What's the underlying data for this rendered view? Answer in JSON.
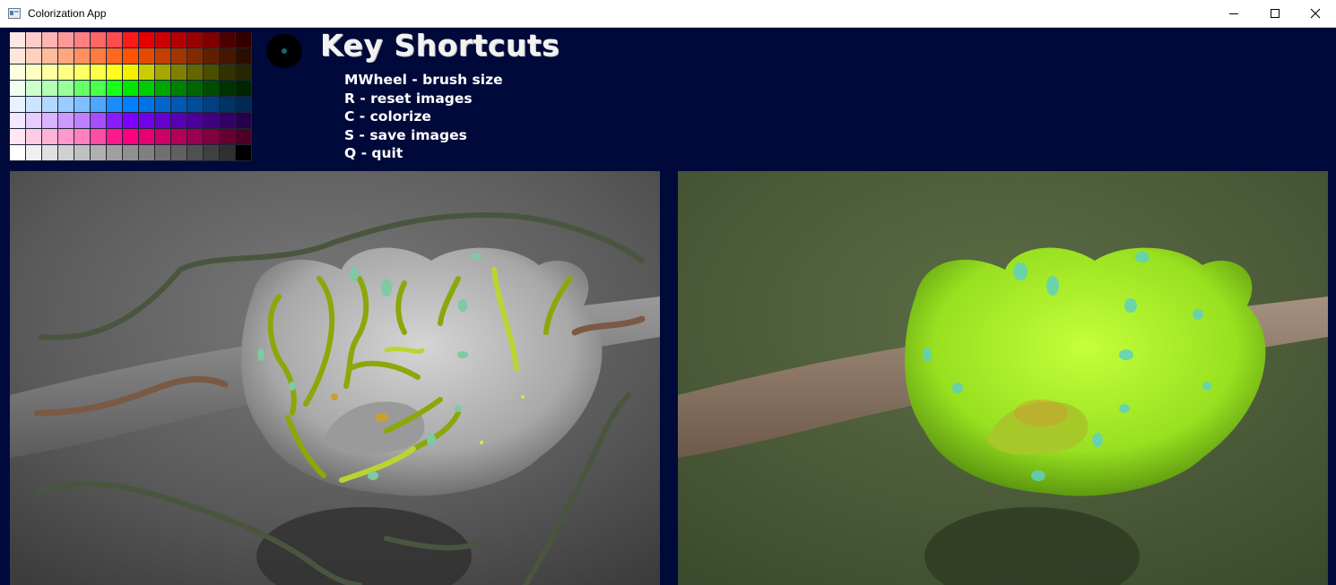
{
  "window": {
    "title": "Colorization App"
  },
  "palette": {
    "rows": [
      [
        "#ffe6e6",
        "#ffcccc",
        "#ffb3b3",
        "#ff9999",
        "#ff8080",
        "#ff6666",
        "#ff4d4d",
        "#ff1a1a",
        "#e60000",
        "#cc0000",
        "#b30000",
        "#990000",
        "#800000",
        "#4d0000",
        "#330000"
      ],
      [
        "#ffe6dc",
        "#ffd0bd",
        "#ffbb9e",
        "#ffa67f",
        "#ff9160",
        "#ff7c41",
        "#ff6722",
        "#ff5203",
        "#e64a00",
        "#c44000",
        "#a33500",
        "#822a00",
        "#611f00",
        "#451600",
        "#2c0e00"
      ],
      [
        "#ffffe0",
        "#ffffc2",
        "#ffffa3",
        "#ffff85",
        "#ffff66",
        "#ffff47",
        "#ffff1f",
        "#f2f200",
        "#cccc00",
        "#a6a600",
        "#808000",
        "#666600",
        "#4d4d00",
        "#333300",
        "#262600"
      ],
      [
        "#f0fff0",
        "#ccffcc",
        "#b3ffb3",
        "#99ff99",
        "#66ff66",
        "#4dff4d",
        "#1aff1a",
        "#00e600",
        "#00cc00",
        "#00a600",
        "#008000",
        "#006600",
        "#004d00",
        "#003300",
        "#002600"
      ],
      [
        "#e6f2ff",
        "#cce5ff",
        "#b3d9ff",
        "#99ccff",
        "#80bfff",
        "#4da6ff",
        "#1a8cff",
        "#0080ff",
        "#0073e6",
        "#0066cc",
        "#0059b3",
        "#004d99",
        "#004080",
        "#003366",
        "#002a55"
      ],
      [
        "#f3e6ff",
        "#e6ccff",
        "#d9b3ff",
        "#cc99ff",
        "#bf80ff",
        "#a64dff",
        "#8c1aff",
        "#8000ff",
        "#7300e6",
        "#6600cc",
        "#5900b3",
        "#4d0099",
        "#400080",
        "#330066",
        "#26004d"
      ],
      [
        "#ffe6f2",
        "#ffcce5",
        "#ffb3d9",
        "#ff99cc",
        "#ff80bf",
        "#ff4da6",
        "#ff1a8c",
        "#ff0080",
        "#e60073",
        "#cc0066",
        "#b30059",
        "#99004d",
        "#800040",
        "#660033",
        "#4d0026"
      ],
      [
        "#ffffff",
        "#f0f0f0",
        "#e0e0e0",
        "#d0d0d0",
        "#c0c0c0",
        "#b0b0b0",
        "#a0a0a0",
        "#909090",
        "#808080",
        "#707070",
        "#606060",
        "#505050",
        "#404040",
        "#303030",
        "#000000"
      ]
    ]
  },
  "brush": {
    "color": "#0d6b6e"
  },
  "shortcuts": {
    "title": "Key Shortcuts",
    "items": [
      "MWheel - brush size",
      "R - reset images",
      "C - colorize",
      "S - save images",
      "Q - quit"
    ]
  },
  "canvases": {
    "input": {
      "name": "grayscale-input-image"
    },
    "output": {
      "name": "colorized-output-image"
    }
  }
}
